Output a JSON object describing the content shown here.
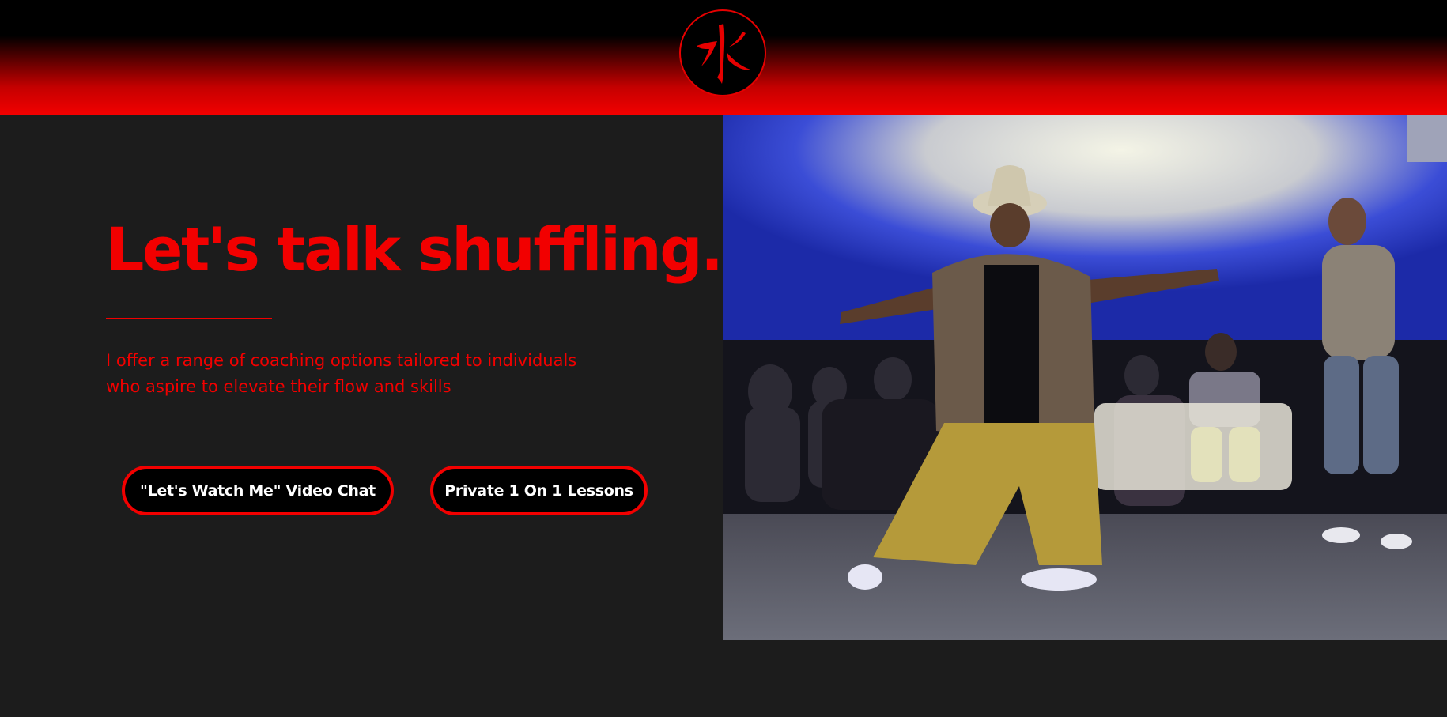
{
  "header": {
    "logo_icon": "water-kanji-logo-icon",
    "logo_glyph": "水",
    "gradient_colors": [
      "#000000",
      "#f20000"
    ]
  },
  "hero": {
    "title": "Let's talk shuffling.",
    "description": "I offer a range of coaching options tailored to individuals who aspire to elevate their flow and skills",
    "accent_color": "#f20000",
    "background_color": "#1c1c1c"
  },
  "buttons": {
    "video_chat_label": "\"Let's Watch Me\" Video Chat",
    "private_lessons_label": "Private 1 On 1 Lessons"
  },
  "photo": {
    "subject": "dance-performance-photo"
  }
}
